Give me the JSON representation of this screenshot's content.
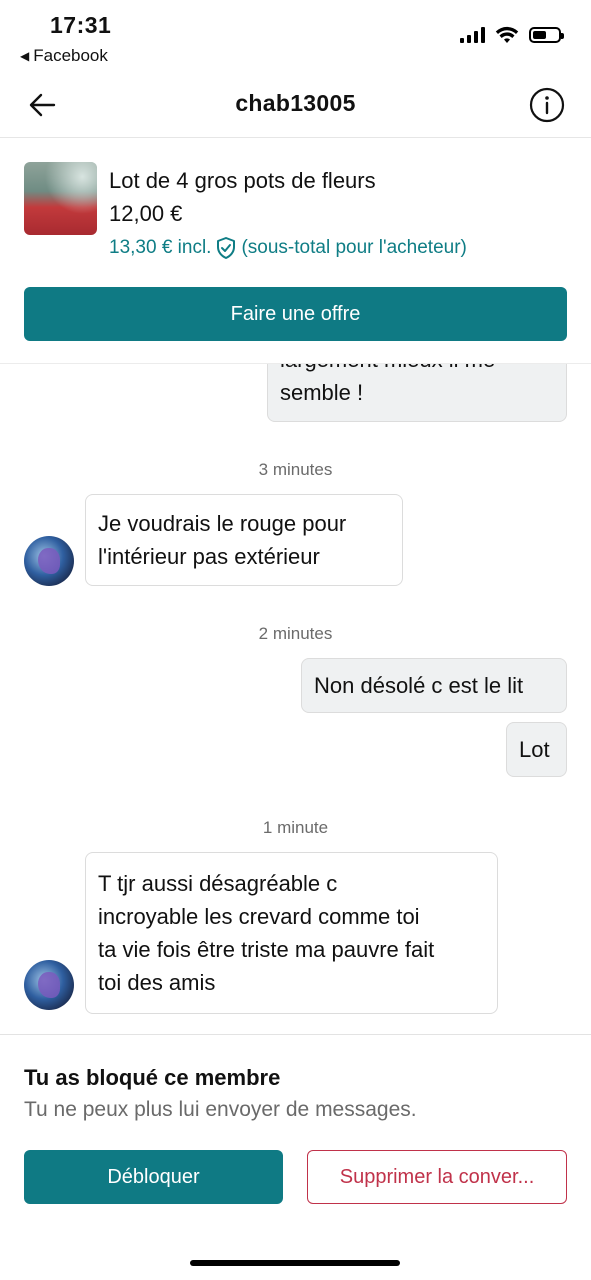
{
  "status_bar": {
    "time": "17:31",
    "back_app": "Facebook",
    "icons": [
      "signal-icon",
      "wifi-icon",
      "battery-icon"
    ]
  },
  "nav": {
    "title": "chab13005",
    "icons": [
      "back-arrow-icon",
      "info-icon"
    ]
  },
  "product": {
    "title": "Lot de 4 gros pots de fleurs",
    "price": "12,00 €",
    "incl_price": "13,30 € incl.",
    "incl_note": "(sous-total pour l'acheteur)",
    "offer_button": "Faire une offre",
    "icons": [
      "shield-check-icon"
    ]
  },
  "chat": {
    "partial_top_line": "largement mieux il me",
    "partial_bottom_line": "semble !",
    "ts1": "3 minutes",
    "msg1_line1": "Je voudrais le rouge pour",
    "msg1_line2": "l'intérieur pas extérieur",
    "ts2": "2 minutes",
    "msg2": "Non désolé c est le lit",
    "msg3": "Lot",
    "ts3": "1 minute",
    "msg4_line1": "T tjr aussi désagréable c",
    "msg4_line2": "incroyable les crevard comme toi",
    "msg4_line3": "ta vie fois être triste ma pauvre fait",
    "msg4_line4": "toi des amis"
  },
  "blocked": {
    "title": "Tu as bloqué ce membre",
    "subtitle": "Tu ne peux plus lui envoyer de messages.",
    "unblock_button": "Débloquer",
    "delete_button": "Supprimer la conver..."
  },
  "colors": {
    "accent": "#0f7a84",
    "accent_text": "#0f7d85",
    "danger": "#c0324a",
    "outgoing_bubble": "#eff1f2"
  }
}
